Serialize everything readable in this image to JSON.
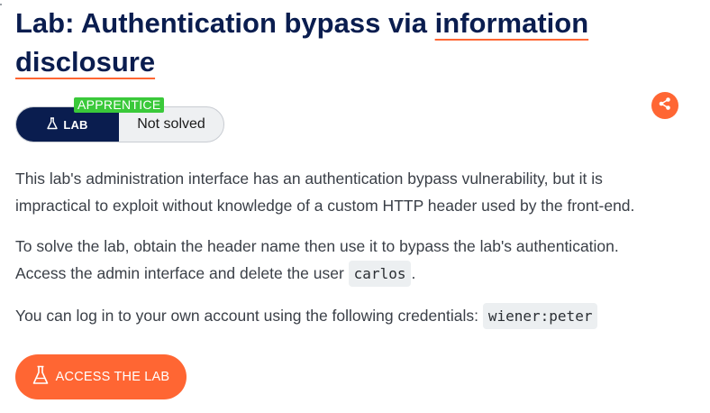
{
  "lab": {
    "title_part1": "Lab: Authentication bypass via ",
    "title_link": "information disclosure",
    "level": "APPRENTICE",
    "badge_label": "LAB",
    "status": "Not solved",
    "share_icon": "share-icon",
    "flask_icon": "flask-icon"
  },
  "description": {
    "p1": "This lab's administration interface has an authentication bypass vulnerability, but it is impractical to exploit without knowledge of a custom HTTP header used by the front-end.",
    "p2_text": "To solve the lab, obtain the header name then use it to bypass the lab's authentication. Access the admin interface and delete the user ",
    "p2_code": "carlos",
    "p2_end": ".",
    "p3_text": "You can log in to your own account using the following credentials: ",
    "p3_code": "wiener:peter"
  },
  "actions": {
    "access_label": "ACCESS THE LAB"
  },
  "colors": {
    "accent": "#ff6633",
    "navy": "#0a1d4f",
    "level_green": "#3ac93a"
  }
}
